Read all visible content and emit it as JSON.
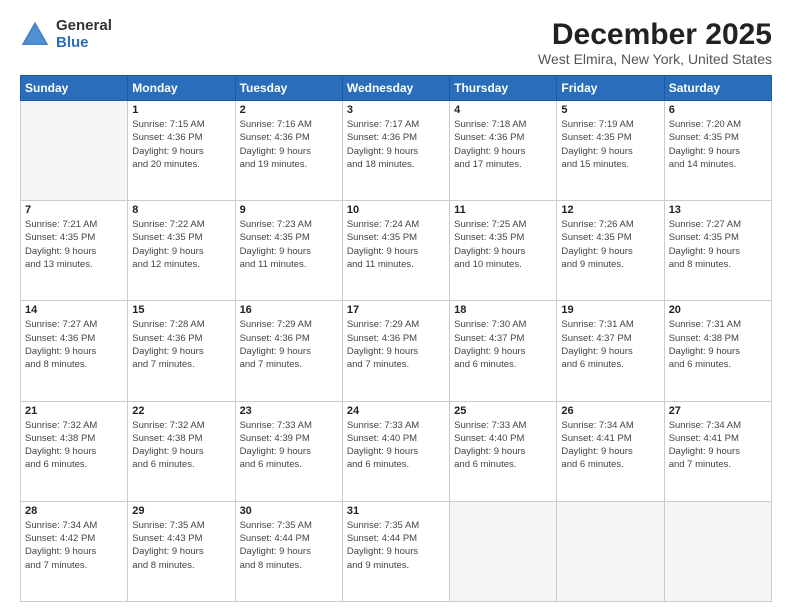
{
  "header": {
    "logo_general": "General",
    "logo_blue": "Blue",
    "title": "December 2025",
    "location": "West Elmira, New York, United States"
  },
  "days_of_week": [
    "Sunday",
    "Monday",
    "Tuesday",
    "Wednesday",
    "Thursday",
    "Friday",
    "Saturday"
  ],
  "weeks": [
    [
      {
        "day": "",
        "info": ""
      },
      {
        "day": "1",
        "info": "Sunrise: 7:15 AM\nSunset: 4:36 PM\nDaylight: 9 hours\nand 20 minutes."
      },
      {
        "day": "2",
        "info": "Sunrise: 7:16 AM\nSunset: 4:36 PM\nDaylight: 9 hours\nand 19 minutes."
      },
      {
        "day": "3",
        "info": "Sunrise: 7:17 AM\nSunset: 4:36 PM\nDaylight: 9 hours\nand 18 minutes."
      },
      {
        "day": "4",
        "info": "Sunrise: 7:18 AM\nSunset: 4:36 PM\nDaylight: 9 hours\nand 17 minutes."
      },
      {
        "day": "5",
        "info": "Sunrise: 7:19 AM\nSunset: 4:35 PM\nDaylight: 9 hours\nand 15 minutes."
      },
      {
        "day": "6",
        "info": "Sunrise: 7:20 AM\nSunset: 4:35 PM\nDaylight: 9 hours\nand 14 minutes."
      }
    ],
    [
      {
        "day": "7",
        "info": "Sunrise: 7:21 AM\nSunset: 4:35 PM\nDaylight: 9 hours\nand 13 minutes."
      },
      {
        "day": "8",
        "info": "Sunrise: 7:22 AM\nSunset: 4:35 PM\nDaylight: 9 hours\nand 12 minutes."
      },
      {
        "day": "9",
        "info": "Sunrise: 7:23 AM\nSunset: 4:35 PM\nDaylight: 9 hours\nand 11 minutes."
      },
      {
        "day": "10",
        "info": "Sunrise: 7:24 AM\nSunset: 4:35 PM\nDaylight: 9 hours\nand 11 minutes."
      },
      {
        "day": "11",
        "info": "Sunrise: 7:25 AM\nSunset: 4:35 PM\nDaylight: 9 hours\nand 10 minutes."
      },
      {
        "day": "12",
        "info": "Sunrise: 7:26 AM\nSunset: 4:35 PM\nDaylight: 9 hours\nand 9 minutes."
      },
      {
        "day": "13",
        "info": "Sunrise: 7:27 AM\nSunset: 4:35 PM\nDaylight: 9 hours\nand 8 minutes."
      }
    ],
    [
      {
        "day": "14",
        "info": "Sunrise: 7:27 AM\nSunset: 4:36 PM\nDaylight: 9 hours\nand 8 minutes."
      },
      {
        "day": "15",
        "info": "Sunrise: 7:28 AM\nSunset: 4:36 PM\nDaylight: 9 hours\nand 7 minutes."
      },
      {
        "day": "16",
        "info": "Sunrise: 7:29 AM\nSunset: 4:36 PM\nDaylight: 9 hours\nand 7 minutes."
      },
      {
        "day": "17",
        "info": "Sunrise: 7:29 AM\nSunset: 4:36 PM\nDaylight: 9 hours\nand 7 minutes."
      },
      {
        "day": "18",
        "info": "Sunrise: 7:30 AM\nSunset: 4:37 PM\nDaylight: 9 hours\nand 6 minutes."
      },
      {
        "day": "19",
        "info": "Sunrise: 7:31 AM\nSunset: 4:37 PM\nDaylight: 9 hours\nand 6 minutes."
      },
      {
        "day": "20",
        "info": "Sunrise: 7:31 AM\nSunset: 4:38 PM\nDaylight: 9 hours\nand 6 minutes."
      }
    ],
    [
      {
        "day": "21",
        "info": "Sunrise: 7:32 AM\nSunset: 4:38 PM\nDaylight: 9 hours\nand 6 minutes."
      },
      {
        "day": "22",
        "info": "Sunrise: 7:32 AM\nSunset: 4:38 PM\nDaylight: 9 hours\nand 6 minutes."
      },
      {
        "day": "23",
        "info": "Sunrise: 7:33 AM\nSunset: 4:39 PM\nDaylight: 9 hours\nand 6 minutes."
      },
      {
        "day": "24",
        "info": "Sunrise: 7:33 AM\nSunset: 4:40 PM\nDaylight: 9 hours\nand 6 minutes."
      },
      {
        "day": "25",
        "info": "Sunrise: 7:33 AM\nSunset: 4:40 PM\nDaylight: 9 hours\nand 6 minutes."
      },
      {
        "day": "26",
        "info": "Sunrise: 7:34 AM\nSunset: 4:41 PM\nDaylight: 9 hours\nand 6 minutes."
      },
      {
        "day": "27",
        "info": "Sunrise: 7:34 AM\nSunset: 4:41 PM\nDaylight: 9 hours\nand 7 minutes."
      }
    ],
    [
      {
        "day": "28",
        "info": "Sunrise: 7:34 AM\nSunset: 4:42 PM\nDaylight: 9 hours\nand 7 minutes."
      },
      {
        "day": "29",
        "info": "Sunrise: 7:35 AM\nSunset: 4:43 PM\nDaylight: 9 hours\nand 8 minutes."
      },
      {
        "day": "30",
        "info": "Sunrise: 7:35 AM\nSunset: 4:44 PM\nDaylight: 9 hours\nand 8 minutes."
      },
      {
        "day": "31",
        "info": "Sunrise: 7:35 AM\nSunset: 4:44 PM\nDaylight: 9 hours\nand 9 minutes."
      },
      {
        "day": "",
        "info": ""
      },
      {
        "day": "",
        "info": ""
      },
      {
        "day": "",
        "info": ""
      }
    ]
  ]
}
